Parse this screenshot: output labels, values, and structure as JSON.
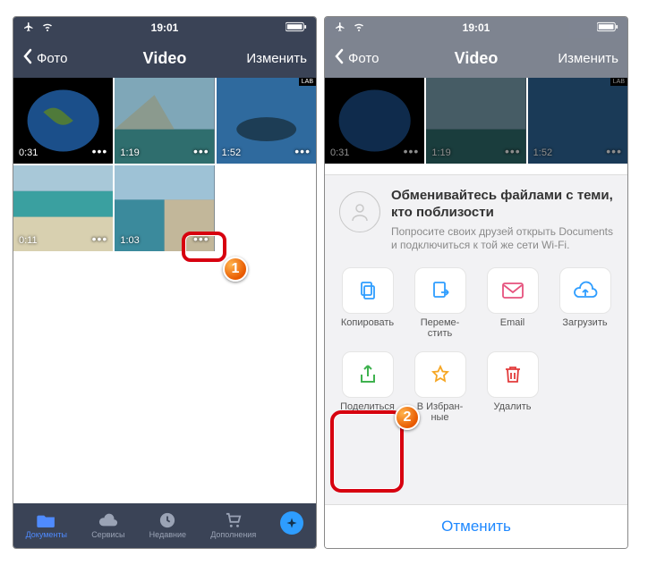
{
  "status": {
    "time": "19:01"
  },
  "nav": {
    "back": "Фото",
    "title": "Video",
    "edit": "Изменить"
  },
  "videos": [
    {
      "duration": "0:31",
      "lab": false
    },
    {
      "duration": "1:19",
      "lab": false
    },
    {
      "duration": "1:52",
      "lab": true
    },
    {
      "duration": "0:11",
      "lab": false
    },
    {
      "duration": "1:03",
      "lab": false
    }
  ],
  "tabs": {
    "documents": "Документы",
    "services": "Сервисы",
    "recent": "Недавние",
    "addons": "Дополнения"
  },
  "sheet": {
    "title": "Обменивайтесь файлами с теми, кто поблизости",
    "sub": "Попросите своих друзей открыть Documents и подключиться к той же сети Wi-Fi."
  },
  "actions": {
    "copy": "Копировать",
    "move": "Переме-\nстить",
    "email": "Email",
    "upload": "Загрузить",
    "share": "Поделиться",
    "fav": "В Избран-\nные",
    "delete": "Удалить"
  },
  "cancel": "Отменить",
  "callouts": {
    "one": "1",
    "two": "2"
  },
  "lab_tag": "LAB"
}
